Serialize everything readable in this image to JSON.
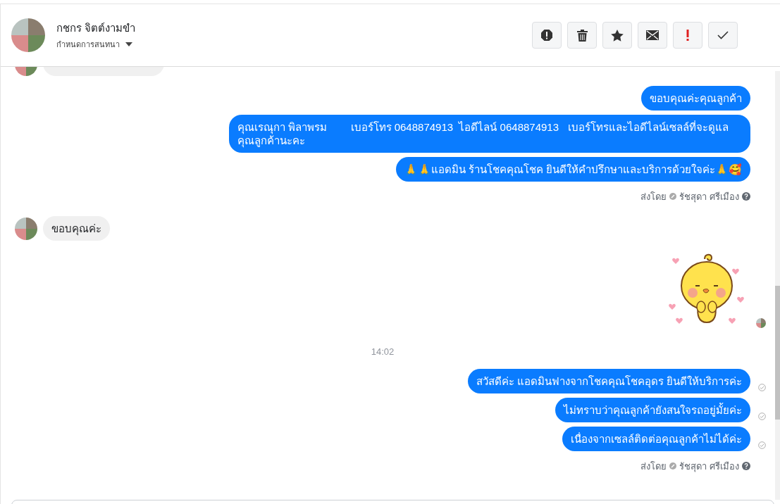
{
  "header": {
    "name": "กชกร จิตต์งามขำ",
    "subtitle": "กำหนดการสนทนา",
    "actions": [
      {
        "kind": "alert"
      },
      {
        "kind": "trash"
      },
      {
        "kind": "star"
      },
      {
        "kind": "mail"
      },
      {
        "kind": "exclaim"
      },
      {
        "kind": "check"
      }
    ]
  },
  "messages": [
    {
      "kind": "incoming_cut"
    },
    {
      "kind": "outgoing",
      "text": "ขอบคุณค่ะคุณลูกค้า",
      "delivered": false
    },
    {
      "kind": "outgoing",
      "text": "คุณเรณุกา พิลาพรม        เบอร์โทร 0648874913  ไอดีไลน์ 0648874913   เบอร์โทรและไอดีไลน์เซลล์ที่จะดูแลคุณลูกค้านะคะ",
      "delivered": false
    },
    {
      "kind": "outgoing",
      "text": "🙏🙏แอดมิน ร้านโชคคุณโชค ยินดีให้คำปรึกษาและบริการด้วยใจค่ะ🙏🥰",
      "delivered": false
    },
    {
      "kind": "sent_by",
      "label": "ส่งโดย",
      "name": "รัชสุดา ศรีเมือง"
    },
    {
      "kind": "incoming",
      "text": "ขอบคุณค่ะ"
    },
    {
      "kind": "sticker"
    },
    {
      "kind": "time",
      "text": "14:02"
    },
    {
      "kind": "outgoing",
      "text": "สวัสดีค่ะ แอดมินฟางจากโชคคุณโชคอุดร ยินดีให้บริการค่ะ",
      "delivered": true
    },
    {
      "kind": "outgoing",
      "text": "ไม่ทราบว่าคุณลูกค้ายังสนใจรถอยู่มั้ยค่ะ",
      "delivered": true
    },
    {
      "kind": "outgoing",
      "text": "เนื่องจากเซลล์ติดต่อคุณลูกค้าไม่ได้ค่ะ",
      "delivered": true
    },
    {
      "kind": "sent_by",
      "label": "ส่งโดย",
      "name": "รัชสุดา ศรีเมือง"
    }
  ]
}
